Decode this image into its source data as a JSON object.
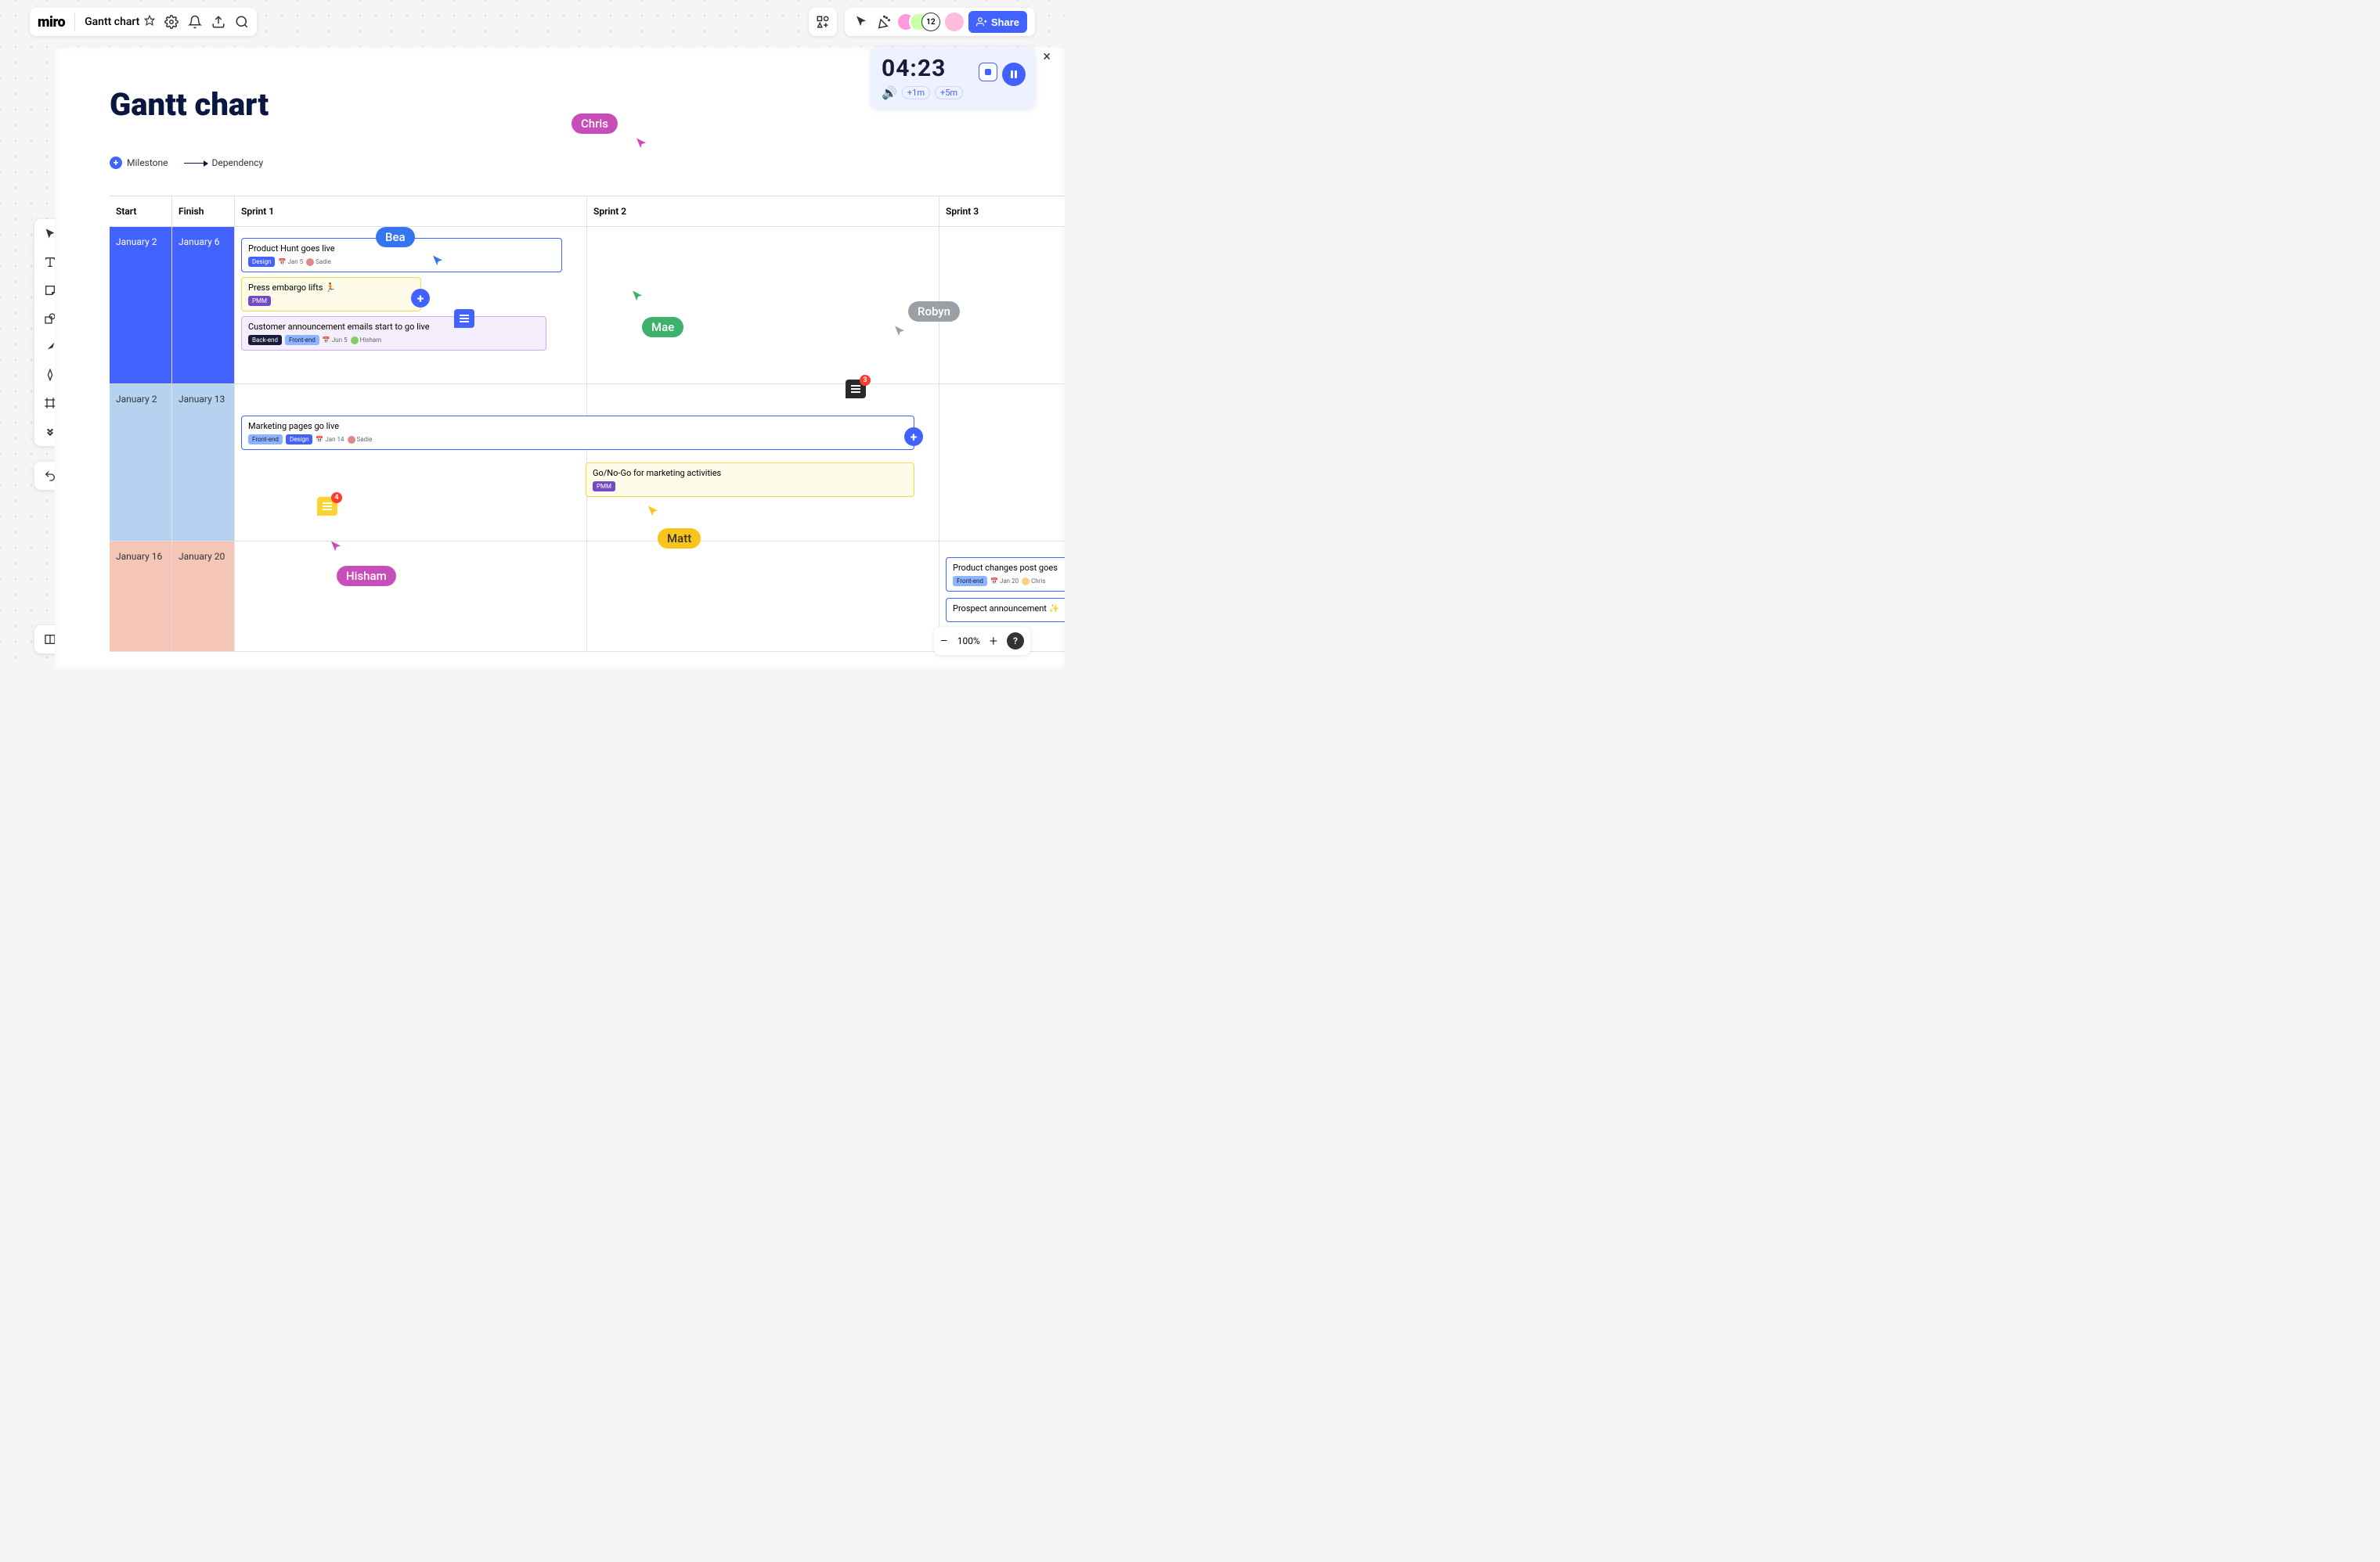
{
  "app": {
    "logo": "miro",
    "board_name": "Gantt chart"
  },
  "collab": {
    "count": "12",
    "share_label": "Share"
  },
  "timer": {
    "time": "04:23",
    "add1": "+1m",
    "add5": "+5m"
  },
  "board": {
    "title": "Gantt chart",
    "legend": {
      "milestone": "Milestone",
      "dependency": "Dependency"
    }
  },
  "columns": {
    "start": "Start",
    "finish": "Finish",
    "sprint1": "Sprint 1",
    "sprint2": "Sprint 2",
    "sprint3": "Sprint 3"
  },
  "rows": [
    {
      "start": "January 2",
      "finish": "January 6"
    },
    {
      "start": "January 2",
      "finish": "January 13"
    },
    {
      "start": "January 16",
      "finish": "January 20"
    }
  ],
  "tasks": {
    "t1": {
      "title": "Product Hunt goes live",
      "tag1": "Design",
      "date": "Jan 5",
      "assignee": "Sadie"
    },
    "t2": {
      "title": "Press embargo lifts 🏃",
      "tag1": "PMM"
    },
    "t3": {
      "title": "Customer announcement emails start to go live",
      "tag1": "Back-end",
      "tag2": "Front-end",
      "date": "Jun 5",
      "assignee": "Hisham"
    },
    "t4": {
      "title": "Marketing pages go live",
      "tag1": "Front-end",
      "tag2": "Design",
      "date": "Jan 14",
      "assignee": "Sadie"
    },
    "t5": {
      "title": "Go/No-Go for marketing activities",
      "tag1": "PMM"
    },
    "t6": {
      "title": "Product changes post goes",
      "tag1": "Front-end",
      "date": "Jan 20",
      "assignee": "Chris"
    },
    "t7": {
      "title": "Prospect announcement ✨"
    }
  },
  "cursors": {
    "chris": "Chris",
    "bea": "Bea",
    "mae": "Mae",
    "robyn": "Robyn",
    "matt": "Matt",
    "hisham": "Hisham"
  },
  "comments": {
    "c1_count": "4",
    "c2_count": "3"
  },
  "zoom": {
    "level": "100%"
  }
}
